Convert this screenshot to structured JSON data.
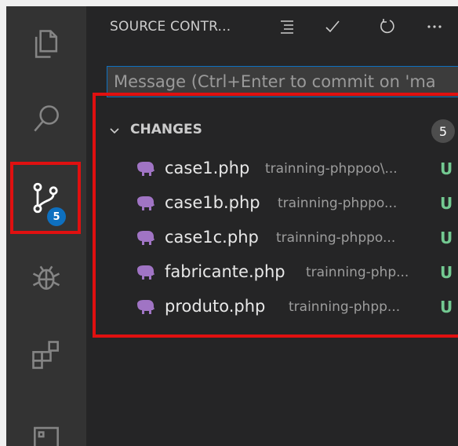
{
  "activity_bar": {
    "items": [
      {
        "name": "explorer-icon"
      },
      {
        "name": "search-icon"
      },
      {
        "name": "source-control-icon",
        "badge": "5",
        "active": true
      },
      {
        "name": "debug-icon"
      },
      {
        "name": "extensions-icon"
      },
      {
        "name": "remote-explorer-icon"
      }
    ]
  },
  "source_control": {
    "title": "SOURCE CONTR...",
    "actions": [
      {
        "name": "view-as-tree-icon"
      },
      {
        "name": "commit-check-icon"
      },
      {
        "name": "refresh-icon"
      },
      {
        "name": "more-actions-icon"
      }
    ],
    "commit_message": {
      "value": "",
      "placeholder": "Message (Ctrl+Enter to commit on 'ma"
    },
    "changes": {
      "label": "CHANGES",
      "count": "5",
      "files": [
        {
          "name": "case1.php",
          "path": "trainning-phppoo\\...",
          "status": "U"
        },
        {
          "name": "case1b.php",
          "path": "trainning-phppo...",
          "status": "U"
        },
        {
          "name": "case1c.php",
          "path": "trainning-phppo...",
          "status": "U"
        },
        {
          "name": "fabricante.php",
          "path": "trainning-php...",
          "status": "U"
        },
        {
          "name": "produto.php",
          "path": "trainning-phpp...",
          "status": "U"
        }
      ]
    }
  },
  "colors": {
    "activity_bar_bg": "#333333",
    "sidebar_bg": "#252526",
    "badge_blue": "#0e70c0",
    "untracked_green": "#73c991",
    "php_icon_purple": "#a074c4",
    "annotation_red": "#e01010"
  }
}
